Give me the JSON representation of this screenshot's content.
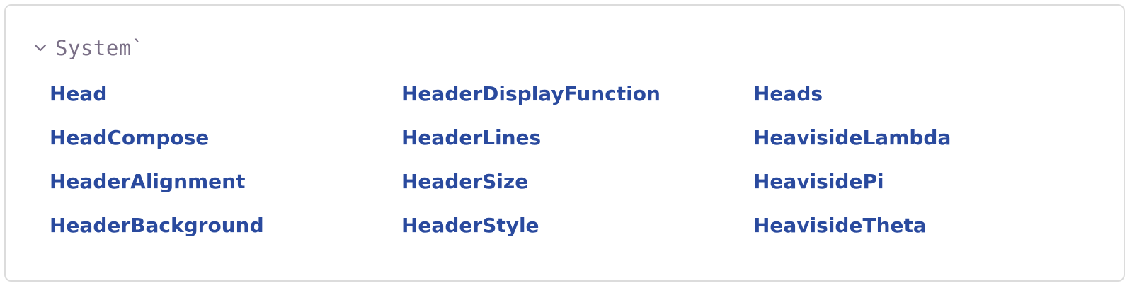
{
  "context": {
    "label": "System`",
    "expanded": true,
    "icon": "chevron-down-icon"
  },
  "colors": {
    "link": "#2a4a9e",
    "context_label": "#7a6f86",
    "border": "#dcdcdc"
  },
  "symbols": {
    "col1": [
      "Head",
      "HeadCompose",
      "HeaderAlignment",
      "HeaderBackground"
    ],
    "col2": [
      "HeaderDisplayFunction",
      "HeaderLines",
      "HeaderSize",
      "HeaderStyle"
    ],
    "col3": [
      "Heads",
      "HeavisideLambda",
      "HeavisidePi",
      "HeavisideTheta"
    ]
  }
}
